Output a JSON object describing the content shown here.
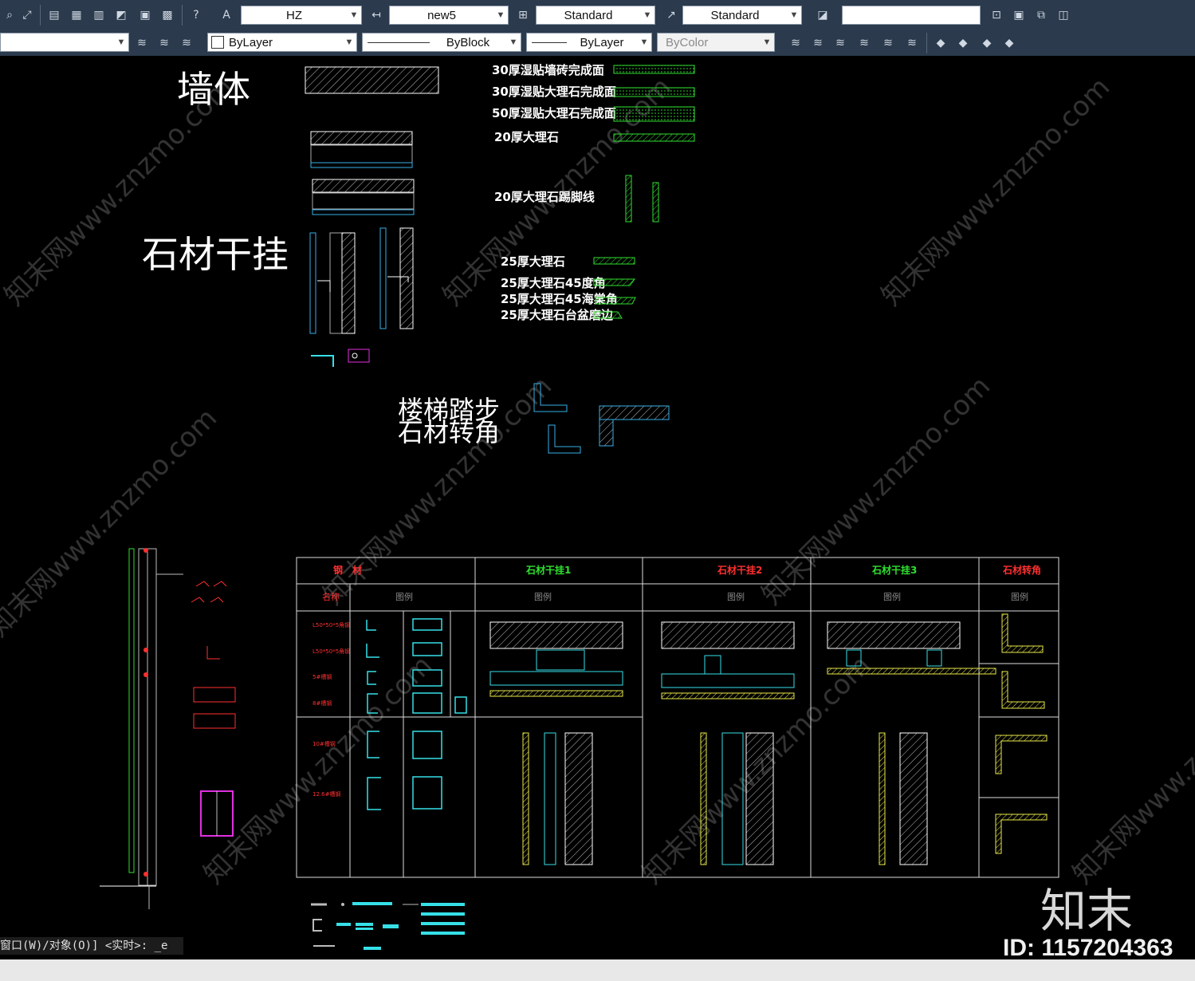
{
  "toolbar1": {
    "text_style": "HZ",
    "dim_style": "new5",
    "table_style": "Standard",
    "mleader_style": "Standard",
    "extra_field": ""
  },
  "toolbar2": {
    "layer": "",
    "color": "ByLayer",
    "linetype": "ByBlock",
    "lineweight": "ByLayer",
    "plotstyle": "ByColor"
  },
  "drawing": {
    "wall_title": "墙体",
    "stone_title": "石材干挂",
    "stair_title_1": "楼梯踏步",
    "stair_title_2": "石材转角",
    "legend_top": [
      "30厚湿贴墙砖完成面",
      "30厚湿贴大理石完成面",
      "50厚湿贴大理石完成面",
      "20厚大理石"
    ],
    "skirting": "20厚大理石踢脚线",
    "legend_25": [
      "25厚大理石",
      "25厚大理石45度角",
      "25厚大理石45海棠角",
      "25厚大理石台盆磨边"
    ],
    "table_headers": [
      "钢　材",
      "石材干挂1",
      "石材干挂2",
      "石材干挂3",
      "石材转角"
    ],
    "table_subheaders": [
      "名称",
      "图例",
      "图例",
      "图例",
      "图例",
      "图例"
    ],
    "steel_names": [
      "L50*50*5角钢",
      "L50*50*5角钢",
      "5#槽钢",
      "8#槽钢",
      "10#槽钢",
      "12.6#槽钢"
    ]
  },
  "command_line": "窗口(W)/对象(O)] <实时>: _e",
  "watermark": {
    "logo": "知末",
    "id": "ID: 1157204363",
    "repeat": "知末网www.znzmo.com"
  },
  "colors": {
    "green": "#2fe02f",
    "cyan": "#36e0e8",
    "yellow": "#e8e84a",
    "red": "#ff3030",
    "magenta": "#e030e0",
    "white": "#ffffff"
  }
}
